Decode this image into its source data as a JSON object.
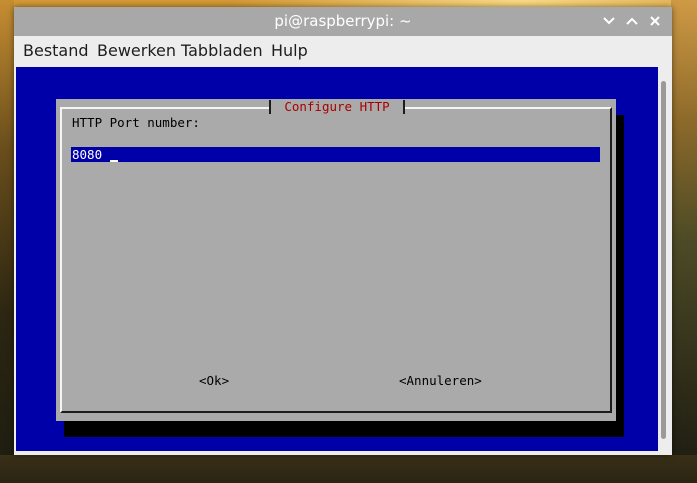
{
  "window": {
    "title": "pi@raspberrypi: ~",
    "controls": {
      "minimize_icon": "chevron-down-icon",
      "maximize_icon": "chevron-up-icon",
      "close_icon": "close-icon"
    }
  },
  "menubar": {
    "items": [
      {
        "label": "Bestand"
      },
      {
        "label": "Bewerken"
      },
      {
        "label": "Tabbladen"
      },
      {
        "label": "Hulp"
      }
    ]
  },
  "dialog": {
    "title": "Configure HTTP",
    "prompt": "HTTP Port number:",
    "input_value": "8080",
    "ok_label": "<Ok>",
    "cancel_label": "<Annuleren>"
  },
  "colors": {
    "terminal_background": "#0000a8",
    "dialog_background": "#aaaaaa",
    "dialog_title": "#a80000",
    "titlebar": "#a8a8a8"
  }
}
